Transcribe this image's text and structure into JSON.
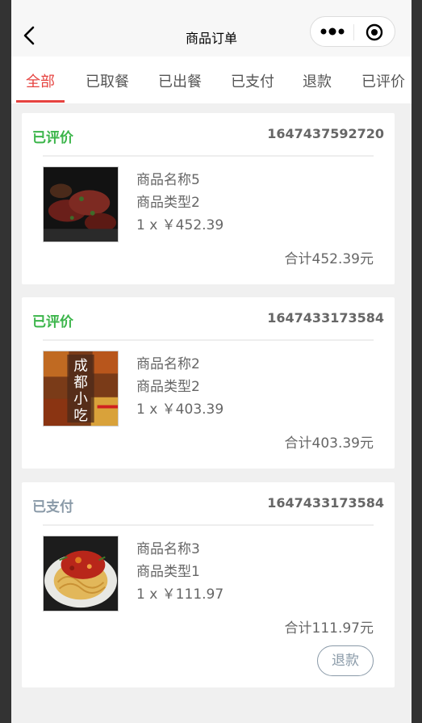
{
  "nav": {
    "title": "商品订单"
  },
  "tabs": [
    {
      "label": "全部"
    },
    {
      "label": "已取餐"
    },
    {
      "label": "已出餐"
    },
    {
      "label": "已支付"
    },
    {
      "label": "退款"
    },
    {
      "label": "已评价"
    }
  ],
  "colors": {
    "accent": "#e64340",
    "reviewed": "#3bb54a",
    "paid": "#8a9aa8"
  },
  "orders": [
    {
      "status": "已评价",
      "order_no": "1647437592720",
      "product_name": "商品名称5",
      "product_type": "商品类型2",
      "qty_price": "1 x ￥452.39",
      "total": "合计452.39元",
      "image": "grilled-steak-photo"
    },
    {
      "status": "已评价",
      "order_no": "1647433173584",
      "product_name": "商品名称2",
      "product_type": "商品类型2",
      "qty_price": "1 x ￥403.39",
      "total": "合计403.39元",
      "image": "chengdu-snacks-photo",
      "image_text": "成都小吃"
    },
    {
      "status": "已支付",
      "order_no": "1647433173584",
      "product_name": "商品名称3",
      "product_type": "商品类型1",
      "qty_price": "1 x ￥111.97",
      "total": "合计111.97元",
      "image": "spaghetti-photo",
      "action": "退款"
    }
  ]
}
